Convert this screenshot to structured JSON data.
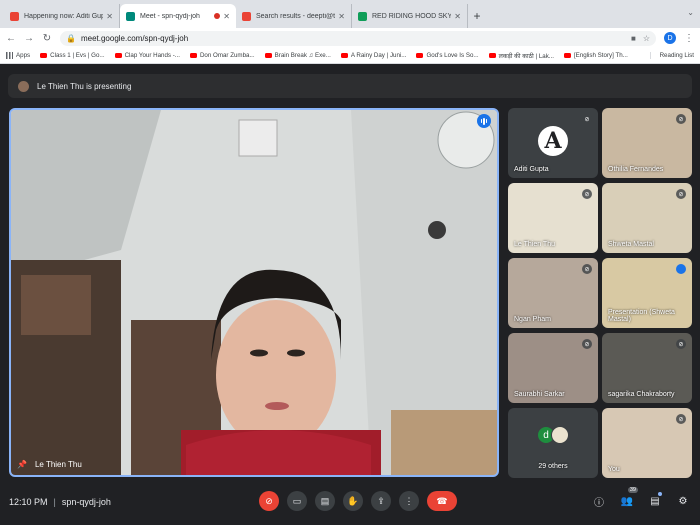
{
  "browser": {
    "tabs": [
      {
        "title": "Happening now: Aditi Gupta is",
        "favicon_color": "#ea4335"
      },
      {
        "title": "Meet - spn-qydj-joh",
        "favicon_color": "#00897b",
        "active": true
      },
      {
        "title": "Search results - deepti@thein",
        "favicon_color": "#ea4335"
      },
      {
        "title": "RED RIDING HOOD SKYPE SES",
        "favicon_color": "#0f9d58"
      }
    ],
    "url": "meet.google.com/spn-qydj-joh",
    "profile_initial": "D",
    "bookmarks": [
      {
        "label": "Apps",
        "icon": "apps-grid-icon"
      },
      {
        "label": "Class 1 | Evs | Go...",
        "icon": "youtube-icon"
      },
      {
        "label": "Clap Your Hands -...",
        "icon": "youtube-icon"
      },
      {
        "label": "Don Omar Zumba...",
        "icon": "youtube-icon"
      },
      {
        "label": "Brain Break ♫ Exe...",
        "icon": "youtube-icon"
      },
      {
        "label": "A Rainy Day | Juni...",
        "icon": "youtube-icon"
      },
      {
        "label": "God's Love Is So...",
        "icon": "youtube-icon"
      },
      {
        "label": "लकड़ी की काठी | Lak...",
        "icon": "youtube-icon"
      },
      {
        "label": "[English Story] Th...",
        "icon": "youtube-icon"
      }
    ],
    "reading_list": "Reading List"
  },
  "meet": {
    "presenting_text": "Le Thien Thu is presenting",
    "main_participant": "Le Thien Thu",
    "participants": [
      {
        "name": "Aditi Gupta",
        "muted": true,
        "kind": "avatar",
        "avatar_letter": "A"
      },
      {
        "name": "Othilia Fernandes",
        "muted": true,
        "kind": "video",
        "bg": "#c9b8a1"
      },
      {
        "name": "Le Thien Thu",
        "muted": true,
        "kind": "screen",
        "bg": "#e6e0d0"
      },
      {
        "name": "Shweta Mastal",
        "muted": true,
        "kind": "video",
        "bg": "#d9cfb8"
      },
      {
        "name": "Ngan Pham",
        "muted": true,
        "kind": "video",
        "bg": "#b6a89b"
      },
      {
        "name": "Presentation (Shweta Mastal)",
        "muted": false,
        "kind": "screen",
        "bg": "#d8c9a3"
      },
      {
        "name": "Saurabhi Sarkar",
        "muted": true,
        "kind": "video",
        "bg": "#9d8f86"
      },
      {
        "name": "sagarika Chakraborty",
        "muted": true,
        "kind": "video",
        "bg": "#5b5a55"
      },
      {
        "name": "29 others",
        "muted": false,
        "kind": "others"
      },
      {
        "name": "You",
        "muted": true,
        "kind": "video",
        "bg": "#d7c8b4"
      }
    ],
    "others_initial": "d",
    "time": "12:10 PM",
    "meeting_code": "spn-qydj-joh",
    "people_count": "39",
    "colors": {
      "accent": "#8ab4f8",
      "danger": "#ea4335",
      "surface": "#3c4043"
    }
  }
}
